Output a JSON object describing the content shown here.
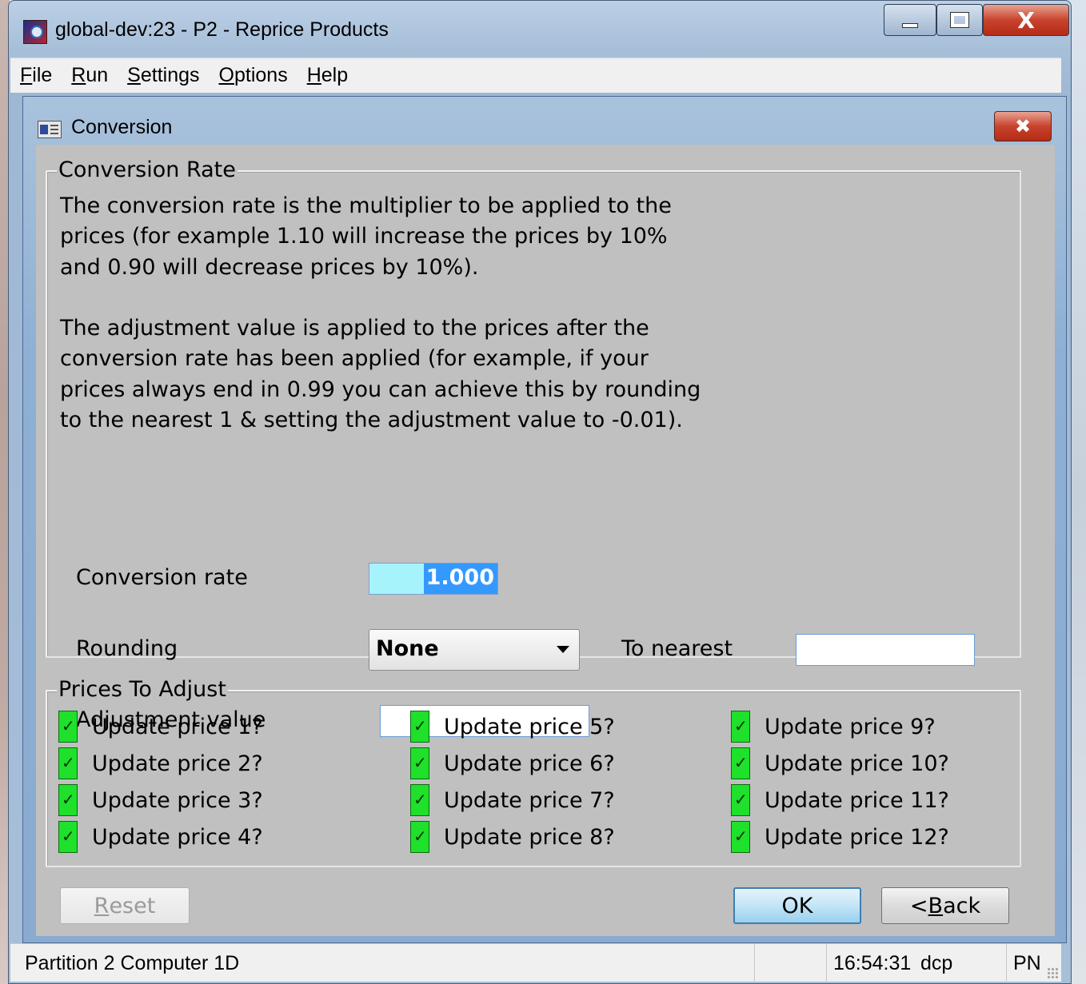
{
  "window": {
    "title": "global-dev:23 - P2 - Reprice Products",
    "controls": {
      "minimize": "minimize",
      "maximize": "maximize",
      "close": "X"
    }
  },
  "menu": [
    {
      "prefix": "",
      "accel": "F",
      "rest": "ile"
    },
    {
      "prefix": "",
      "accel": "R",
      "rest": "un"
    },
    {
      "prefix": "",
      "accel": "S",
      "rest": "ettings"
    },
    {
      "prefix": "",
      "accel": "O",
      "rest": "ptions"
    },
    {
      "prefix": "",
      "accel": "H",
      "rest": "elp"
    }
  ],
  "dialog": {
    "title": "Conversion",
    "close_label": "✖"
  },
  "conversion_rate_group": {
    "legend": "Conversion Rate",
    "description_1": "The conversion rate is the multiplier to be applied to the\nprices (for example 1.10 will increase the prices by 10%\nand 0.90 will decrease prices by 10%).",
    "description_2": "The adjustment value is applied to the prices after the\nconversion rate has been applied (for example, if your\nprices always end in 0.99 you can achieve this by rounding\nto the nearest 1 & setting the adjustment value to -0.01).",
    "conversion_rate_label": "Conversion rate",
    "conversion_rate_value": "1.000",
    "rounding_label": "Rounding",
    "rounding_value": "None",
    "to_nearest_label": "To nearest",
    "to_nearest_value": "",
    "adjustment_label": "Adjustment value",
    "adjustment_value": ""
  },
  "prices_group": {
    "legend": "Prices To Adjust",
    "items": [
      {
        "label": "Update price 1?",
        "checked": true
      },
      {
        "label": "Update price 2?",
        "checked": true
      },
      {
        "label": "Update price 3?",
        "checked": true
      },
      {
        "label": "Update price 4?",
        "checked": true
      },
      {
        "label": "Update price 5?",
        "checked": true
      },
      {
        "label": "Update price 6?",
        "checked": true
      },
      {
        "label": "Update price 7?",
        "checked": true
      },
      {
        "label": "Update price 8?",
        "checked": true
      },
      {
        "label": "Update price 9?",
        "checked": true
      },
      {
        "label": "Update price 10?",
        "checked": true
      },
      {
        "label": "Update price 11?",
        "checked": true
      },
      {
        "label": "Update price 12?",
        "checked": true
      }
    ]
  },
  "buttons": {
    "reset": {
      "accel": "R",
      "rest": "eset"
    },
    "ok": "OK",
    "back": {
      "prefix": "< ",
      "accel": "B",
      "rest": "ack"
    }
  },
  "status_bar": {
    "partition": "Partition 2 Computer 1D",
    "time": "16:54:31",
    "user": "dcp",
    "extra": "PN"
  },
  "colors": {
    "checkbox_checked": "#1fe02a",
    "selection": "#3399ff",
    "rate_field_bg": "#a6f3fb",
    "close_red": "#c8432d"
  }
}
